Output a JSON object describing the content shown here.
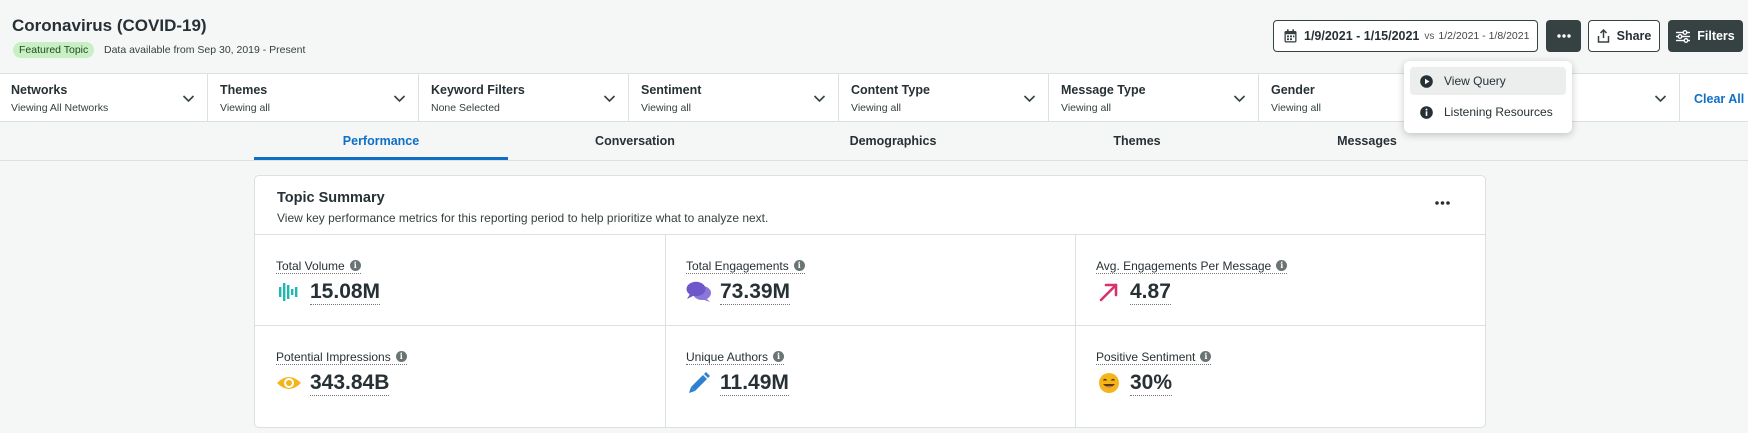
{
  "header": {
    "title": "Coronavirus (COVID-19)",
    "badge": "Featured Topic",
    "data_available": "Data available from Sep 30, 2019 - Present",
    "date_range": "1/9/2021 - 1/15/2021",
    "vs_label": "vs",
    "compare_range": "1/2/2021 - 1/8/2021",
    "share_label": "Share",
    "filters_label": "Filters"
  },
  "filters": [
    {
      "label": "Networks",
      "value": "Viewing All Networks"
    },
    {
      "label": "Themes",
      "value": "Viewing all"
    },
    {
      "label": "Keyword Filters",
      "value": "None Selected"
    },
    {
      "label": "Sentiment",
      "value": "Viewing all"
    },
    {
      "label": "Content Type",
      "value": "Viewing all"
    },
    {
      "label": "Message Type",
      "value": "Viewing all"
    },
    {
      "label": "Gender",
      "value": "Viewing all"
    }
  ],
  "clear_all": "Clear All",
  "tabs": [
    {
      "label": "Performance",
      "active": true
    },
    {
      "label": "Conversation"
    },
    {
      "label": "Demographics"
    },
    {
      "label": "Themes"
    },
    {
      "label": "Messages"
    }
  ],
  "summary": {
    "title": "Topic Summary",
    "subtitle": "View key performance metrics for this reporting period to help prioritize what to analyze next.",
    "metrics": [
      {
        "label": "Total Volume",
        "value": "15.08M",
        "icon": "volume-bars-icon",
        "color": "#1fb8b0"
      },
      {
        "label": "Total Engagements",
        "value": "73.39M",
        "icon": "chat-bubbles-icon",
        "color": "#6e57c9"
      },
      {
        "label": "Avg. Engagements Per Message",
        "value": "4.87",
        "icon": "arrow-up-right-icon",
        "color": "#d6336c"
      },
      {
        "label": "Potential Impressions",
        "value": "343.84B",
        "icon": "eye-icon",
        "color": "#f3b51b"
      },
      {
        "label": "Unique Authors",
        "value": "11.49M",
        "icon": "pencil-icon",
        "color": "#2f80d1"
      },
      {
        "label": "Positive Sentiment",
        "value": "30%",
        "icon": "smile-face-icon",
        "color": "#f3b51b"
      }
    ]
  },
  "menu": {
    "items": [
      {
        "label": "View Query",
        "icon": "play-circle-icon"
      },
      {
        "label": "Listening Resources",
        "icon": "info-circle-icon"
      }
    ]
  }
}
